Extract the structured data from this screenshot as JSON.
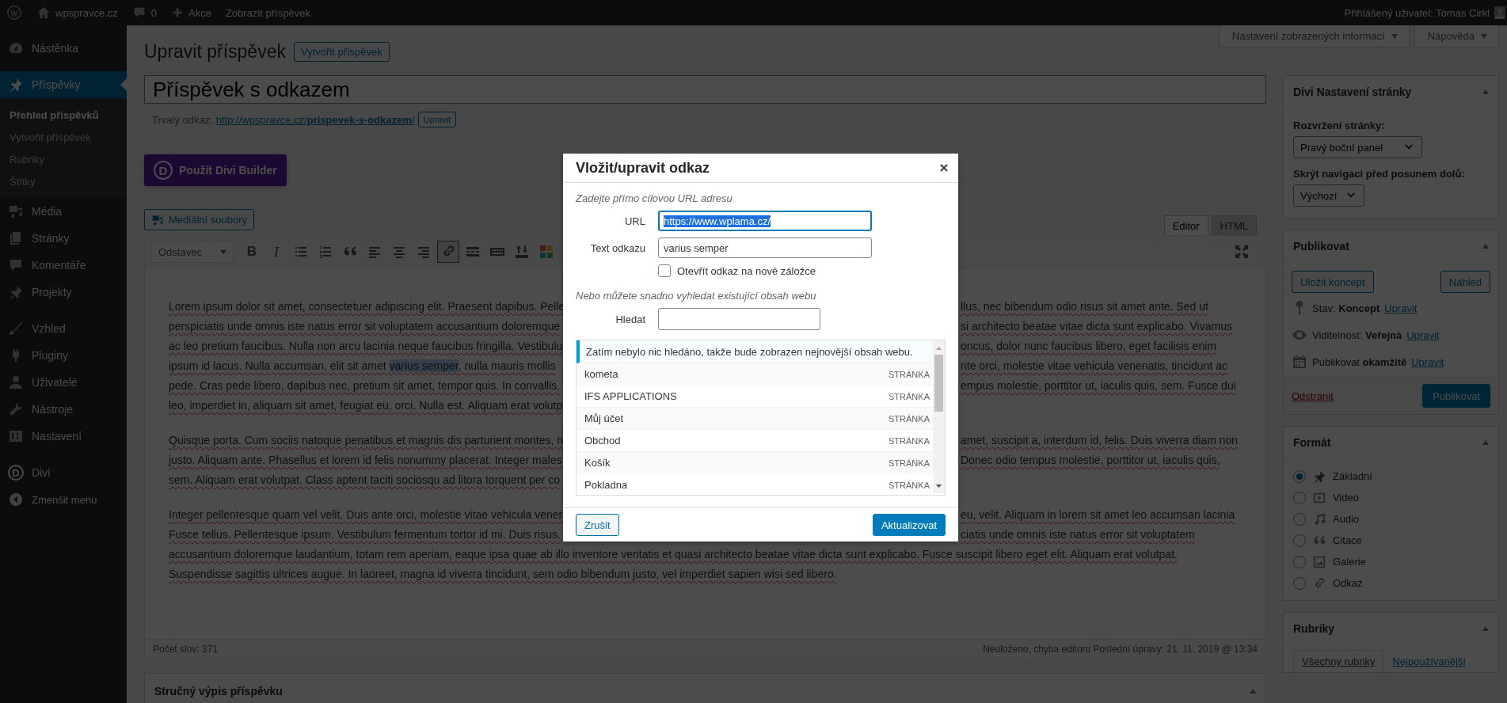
{
  "admin_bar": {
    "site": "wpspravce.cz",
    "comments": "0",
    "new": "Akce",
    "view": "Zobrazit příspěvek",
    "account": "Přihlášený uživatel: Tomas Cirkl"
  },
  "sidebar": {
    "groups": [
      [
        {
          "kind": "menu",
          "label": "Nástěnka",
          "selected": false
        }
      ],
      [
        {
          "kind": "menu",
          "label": "Příspěvky",
          "selected": true,
          "children": [
            {
              "label": "Přehled příspěvků",
              "selected": true
            },
            {
              "label": "Vytvořit příspěvek",
              "selected": false
            },
            {
              "label": "Rubriky",
              "selected": false
            },
            {
              "label": "Štítky",
              "selected": false
            }
          ]
        },
        {
          "kind": "menu",
          "label": "Média",
          "selected": false
        },
        {
          "kind": "menu",
          "label": "Stránky",
          "selected": false
        },
        {
          "kind": "menu",
          "label": "Komentáře",
          "selected": false
        },
        {
          "kind": "menu",
          "label": "Projekty",
          "selected": false
        }
      ],
      [
        {
          "kind": "menu",
          "label": "Vzhled",
          "selected": false
        },
        {
          "kind": "menu",
          "label": "Pluginy",
          "selected": false
        },
        {
          "kind": "menu",
          "label": "Uživatelé",
          "selected": false
        },
        {
          "kind": "menu",
          "label": "Nástroje",
          "selected": false
        },
        {
          "kind": "menu",
          "label": "Nastavení",
          "selected": false
        }
      ],
      [
        {
          "kind": "menu",
          "label": "Divi",
          "letter": "D",
          "selected": false
        },
        {
          "kind": "collapse",
          "label": "Zmenšit menu"
        }
      ]
    ]
  },
  "header": {
    "title": "Upravit příspěvek",
    "add_new": "Vytvořit příspěvek",
    "screen_options": [
      "Nastavení zobrazených informací",
      "Nápověda"
    ]
  },
  "editor": {
    "title_field": {
      "value": "Příspěvek s odkazem"
    },
    "permalink": {
      "label": "Trvalý odkaz:",
      "url": "http://wpspravce.cz/**prispevek-s-odkazem**/",
      "edit": "Upravit"
    },
    "divi_button": {
      "letter": "D",
      "label": "Použít Divi Builder"
    },
    "media_button": "Mediální soubory",
    "tabs": [
      {
        "label": "Editor",
        "selected": true
      },
      {
        "label": "HTML",
        "selected": false
      }
    ],
    "toolbar": {
      "format": "Odstavec",
      "bold": "B",
      "italic": "I",
      "link_active": true
    },
    "paragraphs": [
      [
        {
          "left": "Lorem ipsum dolor sit amet, consectetuer adipiscing elit. Praesent dapibus. Pelle",
          "right": "llus, nec bibendum odio risus sit amet ante. Sed ut"
        },
        {
          "left": "perspiciatis unde omnis iste natus error sit voluptatem accusantium doloremque",
          "right": "si architecto beatae vitae dicta sunt explicabo. Vivamus"
        },
        {
          "left": "ac leo pretium faucibus. Nulla non arcu lacinia neque faucibus fringilla. Vestibulu",
          "right": "oncus, dolor nunc faucibus libero, eget facilisis enim"
        },
        {
          "left": "ipsum id lacus. Nulla accumsan, elit sit amet ",
          "highlight": "varius semper",
          "after": ", nulla mauris mollis",
          "right": "nte orci, molestie vitae vehicula venenatis, tincidunt ac"
        },
        {
          "left": "pede. Cras pede libero, dapibus nec, pretium sit amet, tempor quis. In convallis.",
          "right": "empus molestie, porttitor ut, iaculis quis, sem. Fusce dui"
        },
        {
          "left": "leo, imperdiet in, aliquam sit amet, feugiat eu, orci. Nulla est. Aliquam erat volutp"
        }
      ],
      [
        {
          "left": "Quisque porta. Cum sociis natoque penatibus et magnis dis parturient montes, n",
          "right": "amet, suscipit a, interdum id, felis. Duis viverra diam non"
        },
        {
          "left": "justo. Aliquam ante. Phasellus et lorem id felis nonummy placerat. Integer males",
          "right": "Donec odio tempus molestie, porttitor ut, iaculis quis,"
        },
        {
          "left": "sem. Aliquam erat volutpat. Class aptent taciti sociosqu ad litora torquent per co"
        }
      ],
      [
        {
          "left": "Integer pellentesque quam vel velit. Duis ante orci, molestie vitae vehicula vener",
          "right": "eu, velit. Aliquam in lorem sit amet leo accumsan lacinia"
        },
        {
          "left": "Fusce tellus. Pellentesque ipsum. Vestibulum fermentum tortor id mi. Duis risus.",
          "right": "ciatis unde omnis iste natus error sit voluptatem"
        },
        {
          "left": "accusantium doloremque laudantium, totam rem aperiam, eaque ipsa quae ab illo inventore veritatis et quasi architecto beatae vitae dicta sunt explicabo. Fusce suscipit libero eget elit. Aliquam erat volutpat."
        },
        {
          "left": "Suspendisse sagittis ultrices augue. In laoreet, magna id viverra tincidunt, sem odio bibendum justo, vel imperdiet sapien wisi sed libero."
        }
      ]
    ],
    "word_count": "Počet slov: 371",
    "save_status": "Neuloženo, chyba editoru Poslední úpravy: 21. 11. 2019 @ 13:34",
    "excerpt_title": "Stručný výpis příspěvku"
  },
  "divi_settings": {
    "title": "Divi Nastavení stránky",
    "fields": [
      {
        "label": "Rozvržení stránky:",
        "value": "Pravý boční panel"
      },
      {
        "label": "Skrýt navigaci před posunem dolů:",
        "value": "Výchozí"
      }
    ]
  },
  "publish": {
    "title": "Publikovat",
    "save_draft": "Uložit koncept",
    "preview": "Náhled",
    "rows": [
      {
        "text": "Stav: **Koncept**",
        "link": "Upravit"
      },
      {
        "text": "Viditelnost: **Veřejná**",
        "link": "Upravit"
      },
      {
        "text": "Publikovat **okamžitě**",
        "link": "Upravit"
      }
    ],
    "delete": "Odstranit",
    "publish": "Publikovat"
  },
  "format": {
    "title": "Formát",
    "options": [
      {
        "label": "Základní",
        "selected": true
      },
      {
        "label": "Video",
        "selected": false
      },
      {
        "label": "Audio",
        "selected": false
      },
      {
        "label": "Citace",
        "selected": false
      },
      {
        "label": "Galerie",
        "selected": false
      },
      {
        "label": "Odkaz",
        "selected": false
      }
    ]
  },
  "categories": {
    "title": "Rubriky",
    "tabs": [
      {
        "label": "Všechny rubriky",
        "selected": true
      },
      {
        "label": "Nejpoužívanější",
        "selected": false
      }
    ]
  },
  "link_dialog": {
    "title": "Vložit/upravit odkaz",
    "url_hint": "Zadejte přímo cílovou URL adresu",
    "url": {
      "label": "URL",
      "value": "https://www.wplama.cz/",
      "focused": true,
      "value_selected": true
    },
    "text": {
      "label": "Text odkazu",
      "value": "varius semper"
    },
    "new_tab": {
      "label": "Otevřít odkaz na nové záložce",
      "checked": false
    },
    "search_hint": "Nebo můžete snadno vyhledat existující obsah webu",
    "search": {
      "label": "Hledat"
    },
    "notice": "Zatím nebylo nic hledáno, takže bude zobrazen nejnovější obsah webu.",
    "results": [
      {
        "title": "kometa",
        "type": "STRÁNKA"
      },
      {
        "title": "IFS APPLICATIONS",
        "type": "STRÁNKA"
      },
      {
        "title": "Můj účet",
        "type": "STRÁNKA"
      },
      {
        "title": "Obchod",
        "type": "STRÁNKA"
      },
      {
        "title": "Košík",
        "type": "STRÁNKA"
      },
      {
        "title": "Pokladna",
        "type": "STRÁNKA"
      }
    ],
    "cancel": "Zrušit",
    "submit": "Aktualizovat"
  }
}
